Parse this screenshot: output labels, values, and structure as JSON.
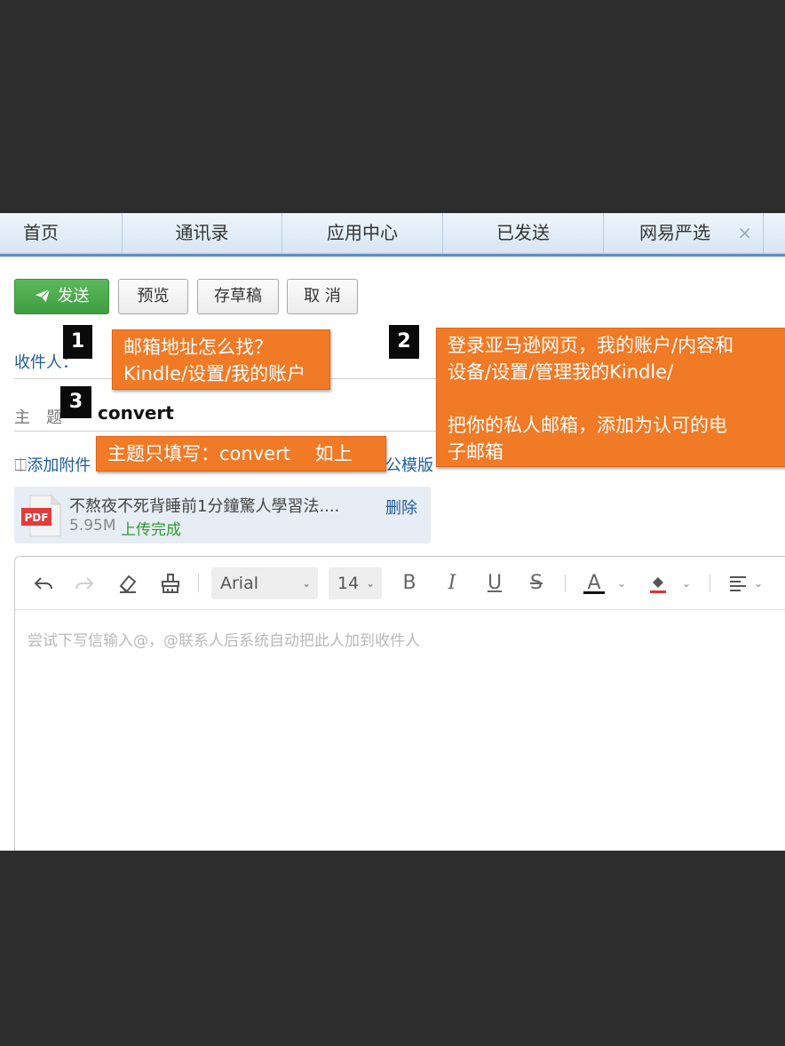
{
  "tabs": [
    {
      "label": "首页"
    },
    {
      "label": "通讯录"
    },
    {
      "label": "应用中心"
    },
    {
      "label": "已发送"
    },
    {
      "label": "网易严选"
    }
  ],
  "toolbar": {
    "send_label": "发送",
    "preview_label": "预览",
    "draft_label": "存草稿",
    "cancel_label": "取 消"
  },
  "compose": {
    "recipient_label": "收件人：",
    "subject_label": "主　题",
    "subject_value": "convert",
    "add_attachment": "添加附件",
    "template_partial": "公模版"
  },
  "annotations": {
    "badge1": "1",
    "badge2": "2",
    "badge3": "3",
    "callout1_line1": "邮箱地址怎么找？",
    "callout1_line2": "Kindle/设置/我的账户",
    "callout2_line1": "登录亚马逊网页，我的账户/内容和",
    "callout2_line2": "设备/设置/管理我的Kindle/",
    "callout2_line3": "把你的私人邮箱，添加为认可的电",
    "callout2_line4": "子邮箱",
    "callout3": "主题只填写：convert　 如上"
  },
  "attachment": {
    "icon": "pdf-file-icon",
    "name": "不熬夜不死背睡前1分鐘驚人學習法....",
    "size": "5.95M",
    "status": "上传完成",
    "delete_label": "删除"
  },
  "editor": {
    "font": "Arial",
    "size": "14",
    "placeholder": "尝试下写信输入@，@联系人后系统自动把此人加到收件人"
  },
  "colors": {
    "send_green": "#4caf50",
    "callout_orange": "#f07a26",
    "link_blue": "#1f5c9c"
  }
}
